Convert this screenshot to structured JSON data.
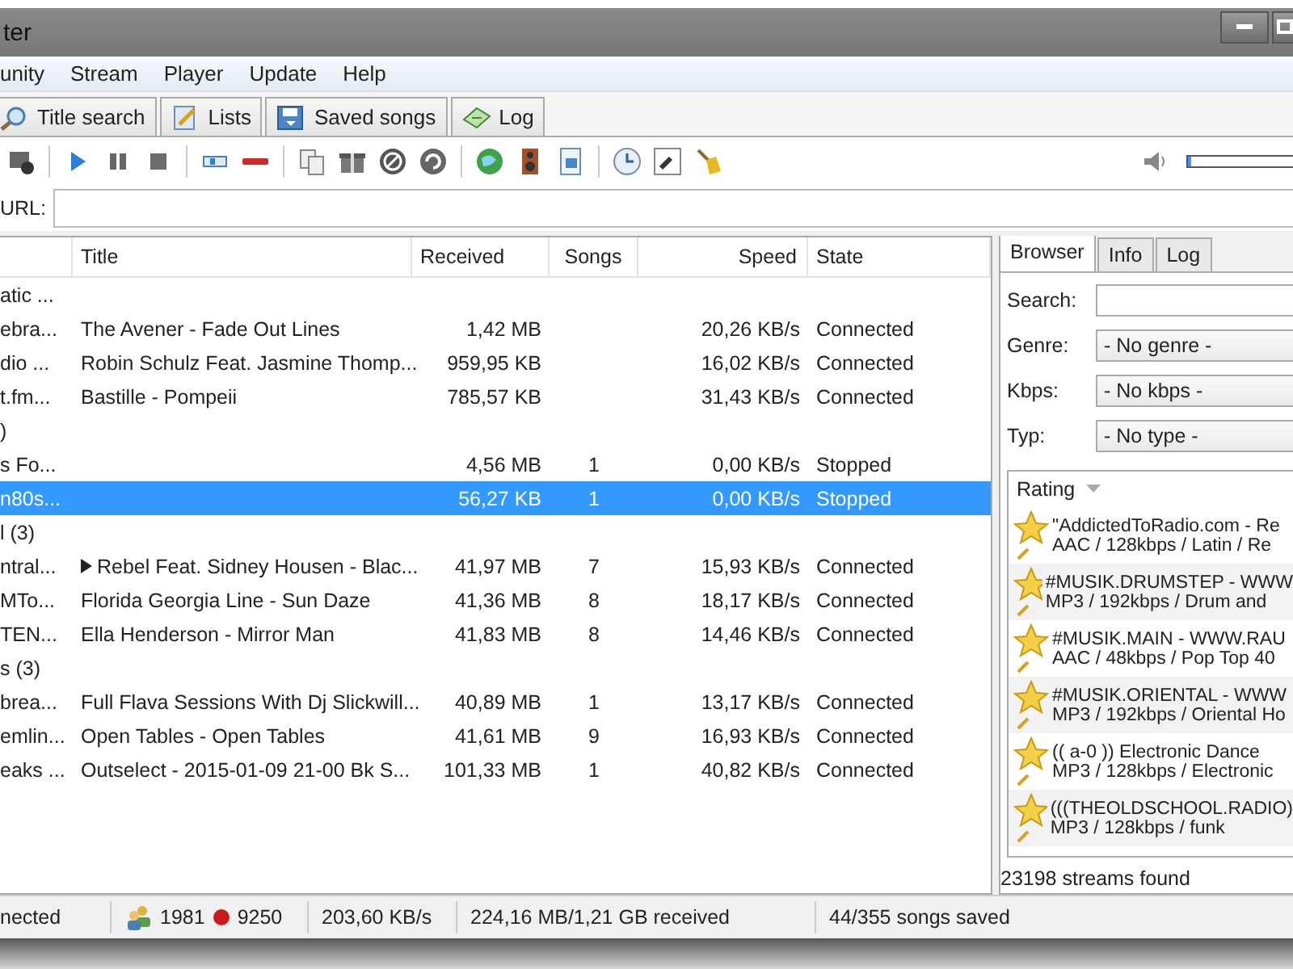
{
  "window": {
    "title": "ter"
  },
  "menu": [
    "unity",
    "Stream",
    "Player",
    "Update",
    "Help"
  ],
  "tabs": [
    {
      "label": "Title search",
      "selected": false
    },
    {
      "label": "Lists",
      "selected": false
    },
    {
      "label": "Saved songs",
      "selected": false
    },
    {
      "label": "Log",
      "selected": false
    }
  ],
  "volume": {
    "level": 0
  },
  "url_label": "URL:",
  "table": {
    "columns": [
      "Title",
      "Received",
      "Songs",
      "Speed",
      "State"
    ],
    "rows": [
      {
        "kind": "group",
        "name": "atic ..."
      },
      {
        "kind": "stream",
        "name": "ebra...",
        "title": "The Avener - Fade Out Lines",
        "playing": false,
        "received": "1,42 MB",
        "songs": "",
        "speed": "20,26 KB/s",
        "state": "Connected",
        "selected": false
      },
      {
        "kind": "stream",
        "name": "dio ...",
        "title": "Robin Schulz Feat. Jasmine Thomp...",
        "playing": false,
        "received": "959,95 KB",
        "songs": "",
        "speed": "16,02 KB/s",
        "state": "Connected",
        "selected": false
      },
      {
        "kind": "stream",
        "name": "t.fm...",
        "title": "Bastille - Pompeii",
        "playing": false,
        "received": "785,57 KB",
        "songs": "",
        "speed": "31,43 KB/s",
        "state": "Connected",
        "selected": false
      },
      {
        "kind": "group",
        "name": ")"
      },
      {
        "kind": "stream",
        "name": "s Fo...",
        "title": "",
        "playing": false,
        "received": "4,56 MB",
        "songs": "1",
        "speed": "0,00 KB/s",
        "state": "Stopped",
        "selected": false
      },
      {
        "kind": "stream",
        "name": "n80s...",
        "title": "",
        "playing": false,
        "received": "56,27 KB",
        "songs": "1",
        "speed": "0,00 KB/s",
        "state": "Stopped",
        "selected": true
      },
      {
        "kind": "group",
        "name": "l (3)"
      },
      {
        "kind": "stream",
        "name": "ntral...",
        "title": "Rebel Feat. Sidney Housen - Blac...",
        "playing": true,
        "received": "41,97 MB",
        "songs": "7",
        "speed": "15,93 KB/s",
        "state": "Connected",
        "selected": false
      },
      {
        "kind": "stream",
        "name": "MTo...",
        "title": "Florida Georgia Line - Sun Daze",
        "playing": false,
        "received": "41,36 MB",
        "songs": "8",
        "speed": "18,17 KB/s",
        "state": "Connected",
        "selected": false
      },
      {
        "kind": "stream",
        "name": "TEN...",
        "title": "Ella Henderson - Mirror Man",
        "playing": false,
        "received": "41,83 MB",
        "songs": "8",
        "speed": "14,46 KB/s",
        "state": "Connected",
        "selected": false
      },
      {
        "kind": "group",
        "name": "s (3)"
      },
      {
        "kind": "stream",
        "name": "brea...",
        "title": "Full Flava Sessions With Dj Slickwill...",
        "playing": false,
        "received": "40,89 MB",
        "songs": "1",
        "speed": "13,17 KB/s",
        "state": "Connected",
        "selected": false
      },
      {
        "kind": "stream",
        "name": "emlin...",
        "title": "Open Tables - Open Tables",
        "playing": false,
        "received": "41,61 MB",
        "songs": "9",
        "speed": "16,93 KB/s",
        "state": "Connected",
        "selected": false
      },
      {
        "kind": "stream",
        "name": "eaks ...",
        "title": "Outselect - 2015-01-09 21-00 Bk S...",
        "playing": false,
        "received": "101,33 MB",
        "songs": "1",
        "speed": "40,82 KB/s",
        "state": "Connected",
        "selected": false
      }
    ]
  },
  "browser": {
    "tabs": [
      {
        "label": "Browser",
        "selected": true
      },
      {
        "label": "Info",
        "selected": false
      },
      {
        "label": "Log",
        "selected": false
      }
    ],
    "search_label": "Search:",
    "filters": [
      {
        "label": "Genre:",
        "value": "- No genre -"
      },
      {
        "label": "Kbps:",
        "value": "- No kbps -"
      },
      {
        "label": "Typ:",
        "value": "- No type -"
      }
    ],
    "sort_label": "Rating",
    "streams": [
      {
        "name": "\"AddictedToRadio.com - Re",
        "info": "AAC / 128kbps / Latin / Re"
      },
      {
        "name": "#MUSIK.DRUMSTEP - WWW",
        "info": "MP3 / 192kbps / Drum and"
      },
      {
        "name": "#MUSIK.MAIN - WWW.RAU",
        "info": "AAC / 48kbps / Pop Top 40"
      },
      {
        "name": "#MUSIK.ORIENTAL - WWW",
        "info": "MP3 / 192kbps / Oriental Ho"
      },
      {
        "name": "(( a-0 )) Electronic Dance",
        "info": "MP3 / 128kbps / Electronic"
      },
      {
        "name": "(((THEOLDSCHOOL.RADIO)",
        "info": "MP3 / 128kbps / funk"
      }
    ],
    "found": "23198 streams found"
  },
  "status_bar": {
    "connection": "nected",
    "clients": "1981",
    "recordings": "9250",
    "speed": "203,60 KB/s",
    "received": "224,16 MB/1,21 GB received",
    "saved": "44/355 songs saved"
  }
}
